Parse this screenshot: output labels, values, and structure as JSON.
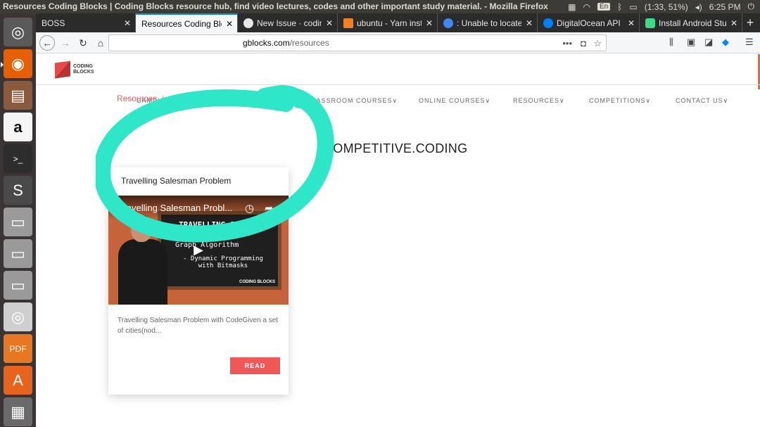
{
  "os": {
    "window_title": "Resources Coding Blocks | Coding Blocks resource hub, find video lectures, codes and other important study material. - Mozilla Firefox",
    "tray": {
      "keyboard": "En",
      "battery": "(1:33, 51%)",
      "time": "6:25 PM"
    },
    "launcher": [
      {
        "name": "ubuntu-dash-icon",
        "glyph": "◎",
        "color": "#5a5a5a"
      },
      {
        "name": "firefox-icon",
        "glyph": "◉",
        "color": "#e66000"
      },
      {
        "name": "files-icon",
        "glyph": "▤",
        "color": "#8b5a3c"
      },
      {
        "name": "amazon-icon",
        "glyph": "a",
        "color": "#f5f5f5"
      },
      {
        "name": "terminal-icon",
        "glyph": ">_",
        "color": "#2d2d2d"
      },
      {
        "name": "sublime-text-icon",
        "glyph": "S",
        "color": "#4a4a4a"
      },
      {
        "name": "drive-icon-1",
        "glyph": "▭",
        "color": "#9a9a9a"
      },
      {
        "name": "drive-icon-2",
        "glyph": "▭",
        "color": "#9a9a9a"
      },
      {
        "name": "drive-icon-3",
        "glyph": "▭",
        "color": "#9a9a9a"
      },
      {
        "name": "dvd-icon",
        "glyph": "◎",
        "color": "#cfcfcf"
      },
      {
        "name": "pdf-app-icon",
        "glyph": "PDF",
        "color": "#e87722"
      },
      {
        "name": "software-center-icon",
        "glyph": "A",
        "color": "#e8641c"
      },
      {
        "name": "trash-icon",
        "glyph": "▦",
        "color": "#6a6a6a"
      }
    ]
  },
  "browser": {
    "tabs": [
      {
        "title": "BOSS",
        "favicon_color": ""
      },
      {
        "title": "Resources Coding Blocks",
        "favicon_color": "",
        "active": true
      },
      {
        "title": "New Issue · coding",
        "favicon_color": "#e6e6e6"
      },
      {
        "title": "ubuntu - Yarn insta",
        "favicon_color": "#f48024"
      },
      {
        "title": ": Unable to locate",
        "favicon_color": "#4285f4"
      },
      {
        "title": "DigitalOcean API",
        "favicon_color": "#0080ff"
      },
      {
        "title": "Install Android Stu",
        "favicon_color": "#3ddc84"
      }
    ],
    "url": {
      "host": "codingblocks.com",
      "path": "/resources",
      "visible_host": "gblocks.com"
    }
  },
  "site": {
    "logo_text_1": "CODING",
    "logo_text_2": "BLOCKS",
    "breadcrumb": "Resources",
    "breadcrumb_sep": "/",
    "nav": [
      {
        "label": "CAMPUS AMBASSADORS",
        "dropdown": false
      },
      {
        "label": "ABOUT US",
        "dropdown": true
      },
      {
        "label": "CLASSROOM COURSES",
        "dropdown": true
      },
      {
        "label": "ONLINE COURSES",
        "dropdown": true
      },
      {
        "label": "RESOURCES",
        "dropdown": true
      },
      {
        "label": "COMPETITIONS",
        "dropdown": true
      },
      {
        "label": "CONTACT US",
        "dropdown": true
      }
    ],
    "heading": "COMPETITIVE.CODING",
    "card": {
      "title": "Travelling Salesman Problem",
      "video_title": "Travelling Salesman Probl...",
      "board_line_1": "TRAVELLING SALESMAN",
      "board_line_2": "PROBLEM",
      "board_line_3": "Graph Algorithm",
      "board_line_4": "- Dynamic Programming",
      "board_line_5": "with Bitmasks",
      "board_logo": "CODING BLOCKS",
      "description": "Travelling Salesman Problem with CodeGiven a set of cities(nod...",
      "button": "READ"
    },
    "accent_color": "#f15757",
    "annotation_color": "#2ee6c8"
  }
}
